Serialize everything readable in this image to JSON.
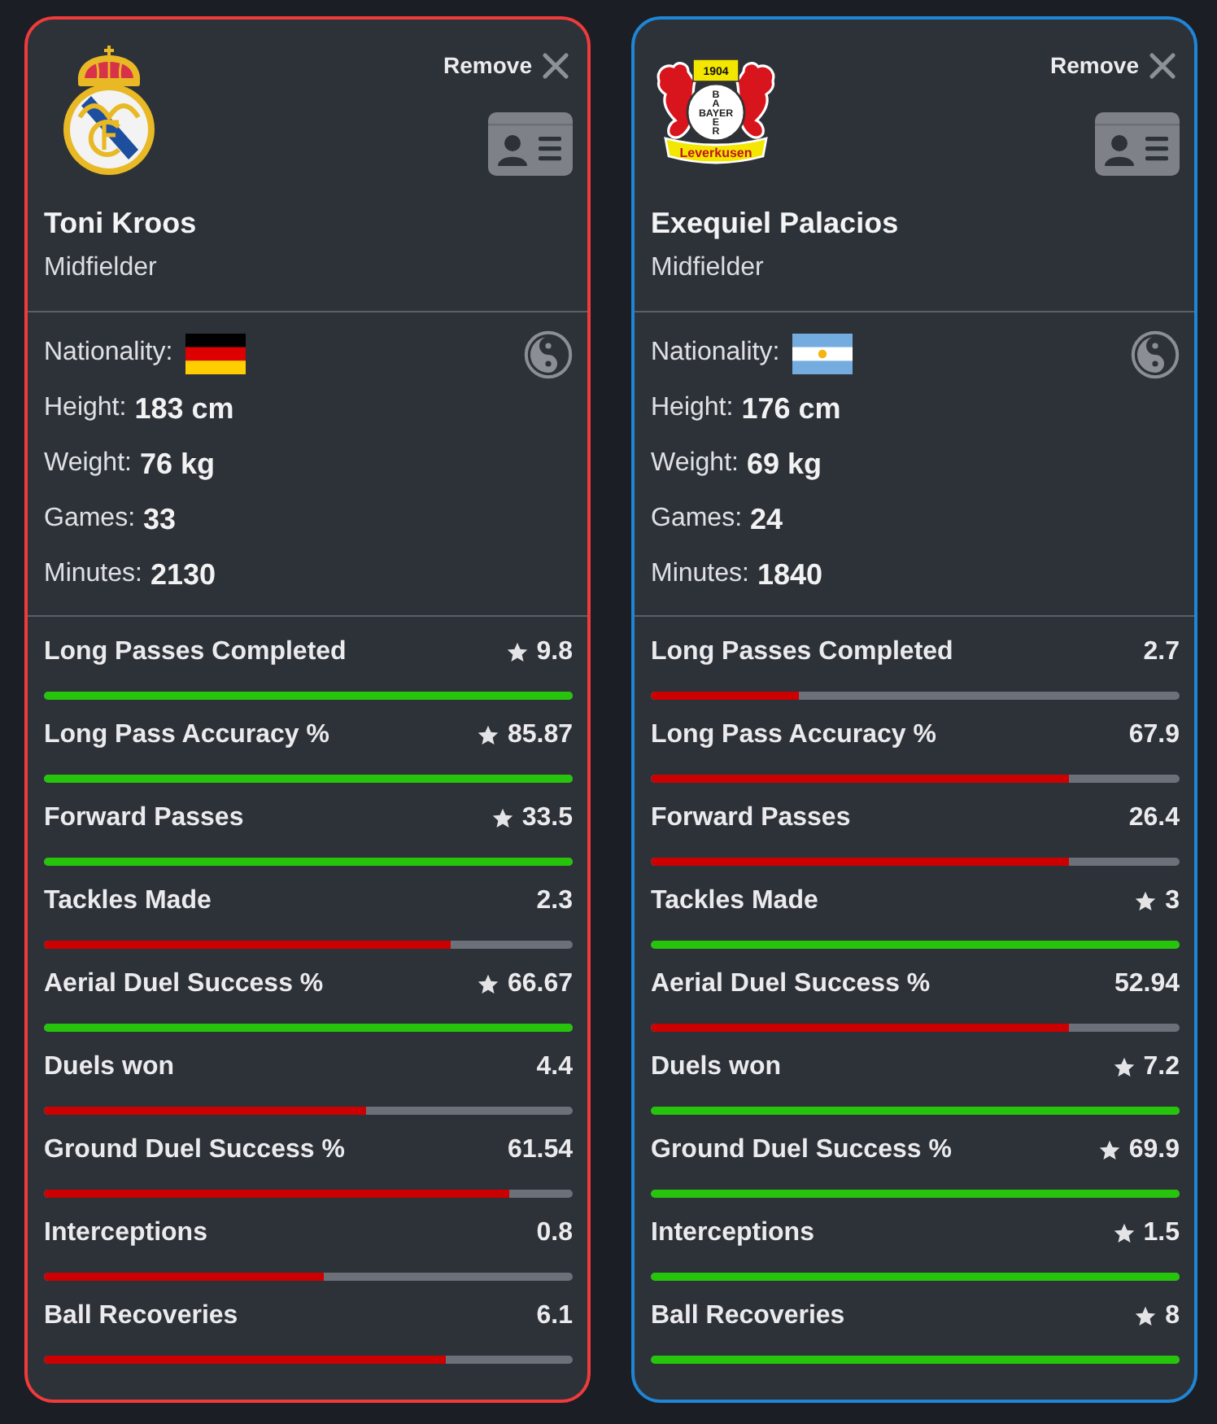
{
  "cards": [
    {
      "color": "#ef3b3b",
      "remove_label": "Remove",
      "name": "Toni Kroos",
      "position": "Midfielder",
      "info": [
        {
          "kind": "flag",
          "label": "Nationality:"
        },
        {
          "kind": "text",
          "label": "Height:",
          "value": "183 cm"
        },
        {
          "kind": "text",
          "label": "Weight:",
          "value": "76 kg"
        },
        {
          "kind": "text",
          "label": "Games:",
          "value": "33"
        },
        {
          "kind": "text",
          "label": "Minutes:",
          "value": "2130"
        }
      ],
      "stats": [
        {
          "label": "Long Passes Completed",
          "value": "9.8",
          "leader": true,
          "level": 1
        },
        {
          "label": "Long Pass Accuracy %",
          "value": "85.87",
          "leader": true,
          "level": 1
        },
        {
          "label": "Forward Passes",
          "value": "33.5",
          "leader": true,
          "level": 1
        },
        {
          "label": "Tackles Made",
          "value": "2.3",
          "leader": false,
          "level": 0.77
        },
        {
          "label": "Aerial Duel Success %",
          "value": "66.67",
          "leader": true,
          "level": 1
        },
        {
          "label": "Duels won",
          "value": "4.4",
          "leader": false,
          "level": 0.61
        },
        {
          "label": "Ground Duel Success %",
          "value": "61.54",
          "leader": false,
          "level": 0.88
        },
        {
          "label": "Interceptions",
          "value": "0.8",
          "leader": false,
          "level": 0.53
        },
        {
          "label": "Ball Recoveries",
          "value": "6.1",
          "leader": false,
          "level": 0.76
        }
      ]
    },
    {
      "color": "#1f86d6",
      "remove_label": "Remove",
      "name": "Exequiel Palacios",
      "position": "Midfielder",
      "crest": {
        "year": "1904",
        "word_across": "BAYER",
        "word_down_top": "BA",
        "word_down_bottom": "ER",
        "ribbon": "Leverkusen"
      },
      "info": [
        {
          "kind": "flag",
          "label": "Nationality:"
        },
        {
          "kind": "text",
          "label": "Height:",
          "value": "176 cm"
        },
        {
          "kind": "text",
          "label": "Weight:",
          "value": "69 kg"
        },
        {
          "kind": "text",
          "label": "Games:",
          "value": "24"
        },
        {
          "kind": "text",
          "label": "Minutes:",
          "value": "1840"
        }
      ],
      "stats": [
        {
          "label": "Long Passes Completed",
          "value": "2.7",
          "leader": false,
          "level": 0.28
        },
        {
          "label": "Long Pass Accuracy %",
          "value": "67.9",
          "leader": false,
          "level": 0.79
        },
        {
          "label": "Forward Passes",
          "value": "26.4",
          "leader": false,
          "level": 0.79
        },
        {
          "label": "Tackles Made",
          "value": "3",
          "leader": true,
          "level": 1
        },
        {
          "label": "Aerial Duel Success %",
          "value": "52.94",
          "leader": false,
          "level": 0.79
        },
        {
          "label": "Duels won",
          "value": "7.2",
          "leader": true,
          "level": 1
        },
        {
          "label": "Ground Duel Success %",
          "value": "69.9",
          "leader": true,
          "level": 1
        },
        {
          "label": "Interceptions",
          "value": "1.5",
          "leader": true,
          "level": 1
        },
        {
          "label": "Ball Recoveries",
          "value": "8",
          "leader": true,
          "level": 1
        }
      ]
    }
  ]
}
